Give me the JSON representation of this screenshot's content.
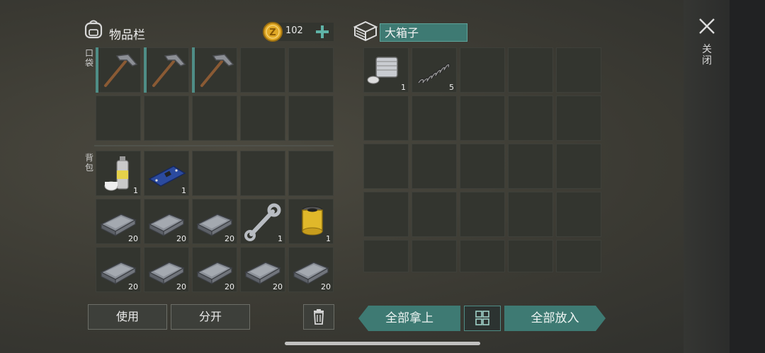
{
  "inventory": {
    "title": "物品栏",
    "coins": "102",
    "pocket_label": "口袋",
    "backpack_label": "背包",
    "pocket_slots": [
      {
        "item": "pickaxe-icon",
        "count": ""
      },
      {
        "item": "pickaxe-icon",
        "count": ""
      },
      {
        "item": "pickaxe-icon",
        "count": ""
      },
      {
        "item": "",
        "count": ""
      },
      {
        "item": "",
        "count": ""
      },
      {
        "item": "",
        "count": ""
      },
      {
        "item": "",
        "count": ""
      },
      {
        "item": "",
        "count": ""
      },
      {
        "item": "",
        "count": ""
      },
      {
        "item": "",
        "count": ""
      }
    ],
    "backpack_slots": [
      {
        "item": "spray-can-icon",
        "count": "1"
      },
      {
        "item": "circuit-board-icon",
        "count": "1"
      },
      {
        "item": "",
        "count": ""
      },
      {
        "item": "",
        "count": ""
      },
      {
        "item": "",
        "count": ""
      },
      {
        "item": "iron-bar-icon",
        "count": "20"
      },
      {
        "item": "iron-bar-icon",
        "count": "20"
      },
      {
        "item": "iron-bar-icon",
        "count": "20"
      },
      {
        "item": "wrench-icon",
        "count": "1"
      },
      {
        "item": "oil-filter-icon",
        "count": "1"
      },
      {
        "item": "iron-bar-icon",
        "count": "20"
      },
      {
        "item": "iron-bar-icon",
        "count": "20"
      },
      {
        "item": "iron-bar-icon",
        "count": "20"
      },
      {
        "item": "iron-bar-icon",
        "count": "20"
      },
      {
        "item": "iron-bar-icon",
        "count": "20"
      }
    ],
    "use_label": "使用",
    "split_label": "分开"
  },
  "chest": {
    "name": "大箱子",
    "slots": [
      {
        "item": "engine-cylinder-icon",
        "count": "1"
      },
      {
        "item": "spring-icon",
        "count": "5"
      }
    ],
    "take_all_label": "全部拿上",
    "put_all_label": "全部放入"
  },
  "close": {
    "label": "关闭"
  },
  "colors": {
    "accent": "#3e7a73",
    "slot_bg": "#33352f",
    "coin": "#e0a826"
  }
}
